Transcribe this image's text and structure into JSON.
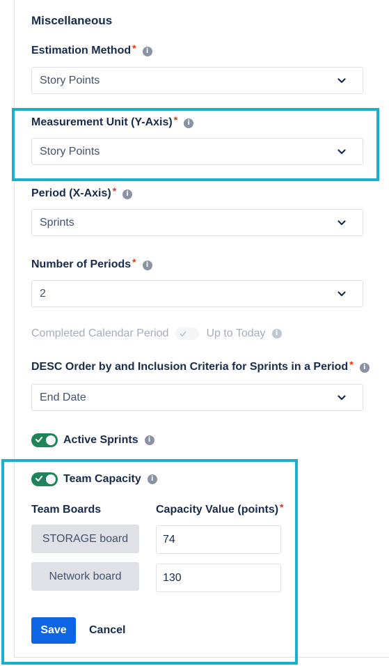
{
  "section_title": "Miscellaneous",
  "fields": {
    "estimation_method": {
      "label": "Estimation Method",
      "value": "Story Points"
    },
    "measurement_unit": {
      "label": "Measurement Unit (Y-Axis)",
      "value": "Story Points"
    },
    "period": {
      "label": "Period (X-Axis)",
      "value": "Sprints"
    },
    "number_of_periods": {
      "label": "Number of Periods",
      "value": "2"
    },
    "completed_period": {
      "left_label": "Completed Calendar Period",
      "right_label": "Up to Today"
    },
    "desc_order": {
      "label": "DESC Order by and Inclusion Criteria for Sprints in a Period",
      "value": "End Date"
    }
  },
  "toggles": {
    "active_sprints": {
      "label": "Active Sprints",
      "on": true
    },
    "team_capacity": {
      "label": "Team Capacity",
      "on": true
    }
  },
  "capacity": {
    "boards_header": "Team Boards",
    "value_header": "Capacity Value (points)",
    "rows": [
      {
        "board": "STORAGE board",
        "value": "74"
      },
      {
        "board": "Network board",
        "value": "130"
      }
    ]
  },
  "actions": {
    "save": "Save",
    "cancel": "Cancel"
  },
  "required_mark": "*",
  "info_glyph": "i",
  "colors": {
    "primary": "#0c66e4",
    "toggle_on": "#1f845a",
    "highlight": "#19b0cc",
    "required": "#de350b"
  }
}
